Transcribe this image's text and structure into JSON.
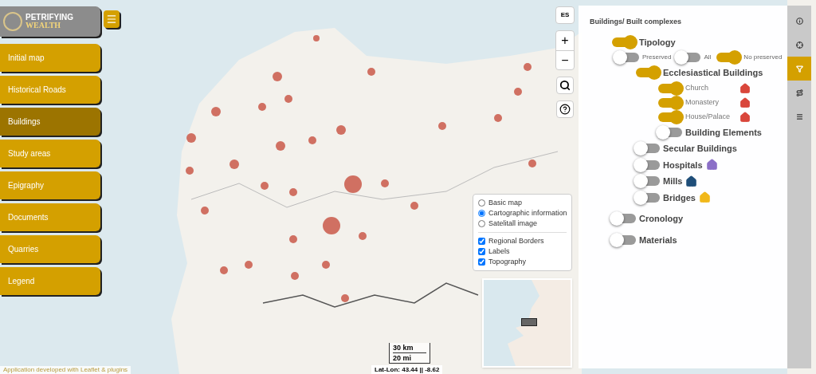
{
  "logo": {
    "line1": "PETRIFYING",
    "line2": "WEALTH"
  },
  "nav": [
    {
      "label": "Initial map",
      "selected": false
    },
    {
      "label": "Historical Roads",
      "selected": false
    },
    {
      "label": "Buildings",
      "selected": true
    },
    {
      "label": "Study areas",
      "selected": false
    },
    {
      "label": "Epigraphy",
      "selected": false
    },
    {
      "label": "Documents",
      "selected": false
    },
    {
      "label": "Quarries",
      "selected": false
    },
    {
      "label": "Legend",
      "selected": false
    }
  ],
  "map_controls": {
    "language": "ES",
    "zoom_in": "+",
    "zoom_out": "−"
  },
  "layers": {
    "base": [
      {
        "label": "Basic map",
        "selected": false
      },
      {
        "label": "Cartographic information",
        "selected": true
      },
      {
        "label": "Satelitall image",
        "selected": false
      }
    ],
    "overlays": [
      {
        "label": "Regional Borders",
        "checked": true
      },
      {
        "label": "Labels",
        "checked": true
      },
      {
        "label": "Topography",
        "checked": true
      }
    ]
  },
  "scale": {
    "metric": "30 km",
    "imperial": "20 mi"
  },
  "coordinates": "Lat-Lon: 43.44 || -8.62",
  "attribution": "Application developed with Leaflet & plugins",
  "panel": {
    "title": "Buildings/ Built complexes",
    "filters": [
      {
        "kind": "group",
        "label": "Tipology",
        "on": true,
        "children": [
          {
            "kind": "options",
            "options": [
              {
                "label": "Preserved",
                "on": false
              },
              {
                "label": "All",
                "on": false
              },
              {
                "label": "No preserved",
                "on": true
              }
            ]
          },
          {
            "kind": "group",
            "label": "Ecclesiastical Buildings",
            "on": true,
            "children": [
              {
                "kind": "type",
                "label": "Church",
                "on": true,
                "color": "#d9463b"
              },
              {
                "kind": "type",
                "label": "Monastery",
                "on": true,
                "color": "#d9463b"
              },
              {
                "kind": "type",
                "label": "House/Palace",
                "on": true,
                "color": "#d9463b"
              },
              {
                "kind": "group",
                "label": "Building Elements",
                "on": false
              }
            ]
          },
          {
            "kind": "group",
            "label": "Secular Buildings",
            "on": false
          },
          {
            "kind": "group",
            "label": "Hospitals",
            "on": false,
            "color": "#8b6fc7"
          },
          {
            "kind": "group",
            "label": "Mills",
            "on": false,
            "color": "#1f4e79"
          },
          {
            "kind": "group",
            "label": "Bridges",
            "on": false,
            "color": "#f1b81a"
          }
        ]
      },
      {
        "kind": "group",
        "label": "Cronology",
        "on": false
      },
      {
        "kind": "group",
        "label": "Materials",
        "on": false
      }
    ]
  },
  "side_tabs": [
    {
      "kind": "info",
      "selected": false
    },
    {
      "kind": "target",
      "selected": false
    },
    {
      "kind": "filter",
      "selected": true
    },
    {
      "kind": "road",
      "selected": false
    },
    {
      "kind": "list",
      "selected": false
    }
  ]
}
